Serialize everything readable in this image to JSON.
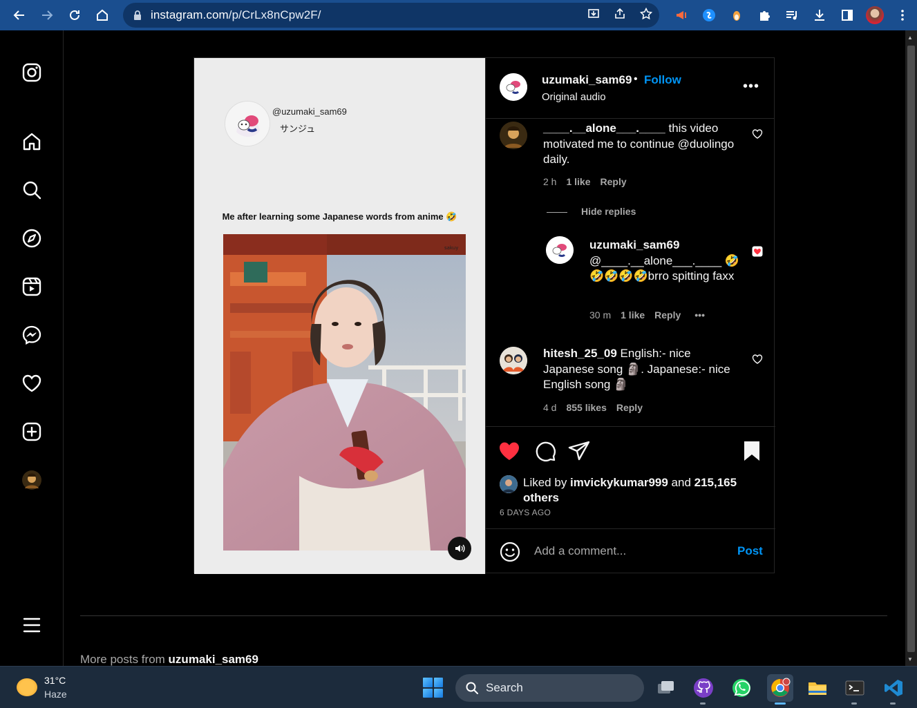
{
  "browser": {
    "url_domain": "instagram.com",
    "url_path": "/p/CrLx8nCpw2F/"
  },
  "post": {
    "media": {
      "tt_handle": "@uzumaki_sam69",
      "tt_name": "サンジュ",
      "caption": "Me after learning some Japanese words from anime 🤣"
    },
    "header": {
      "username": "uzumaki_sam69",
      "separator": "•",
      "follow": "Follow",
      "audio": "Original audio",
      "more": "•••"
    },
    "comments": [
      {
        "user": "____.__alone___.____",
        "text": " this video motivated me to continue @duolingo daily.",
        "time": "2 h",
        "likes": "1 like",
        "reply": "Reply"
      },
      {
        "user": "uzumaki_sam69",
        "text": "@____.__alone___.____ 🤣🤣🤣🤣🤣brro spitting faxx",
        "time": "30 m",
        "likes": "1 like",
        "reply": "Reply",
        "more": "•••"
      },
      {
        "user": "hitesh_25_09",
        "text": " English:- nice Japanese song 🗿. Japanese:- nice English song 🗿",
        "time": "4 d",
        "likes": "855 likes",
        "reply": "Reply"
      }
    ],
    "hide_replies": "Hide replies",
    "liked_by_prefix": "Liked by ",
    "liked_by_user": "imvickykumar999",
    "liked_by_mid": " and ",
    "liked_by_count": "215,165 others",
    "posted_ago": "6 DAYS AGO",
    "comment_placeholder": "Add a comment...",
    "post_button": "Post"
  },
  "more_posts": {
    "prefix": "More posts from ",
    "user": "uzumaki_sam69"
  },
  "taskbar": {
    "temperature": "31°C",
    "condition": "Haze",
    "search_label": "Search"
  },
  "colors": {
    "link_blue": "#0095f6",
    "like_red": "#ff3040",
    "chrome_blue": "#1a4e8f"
  }
}
